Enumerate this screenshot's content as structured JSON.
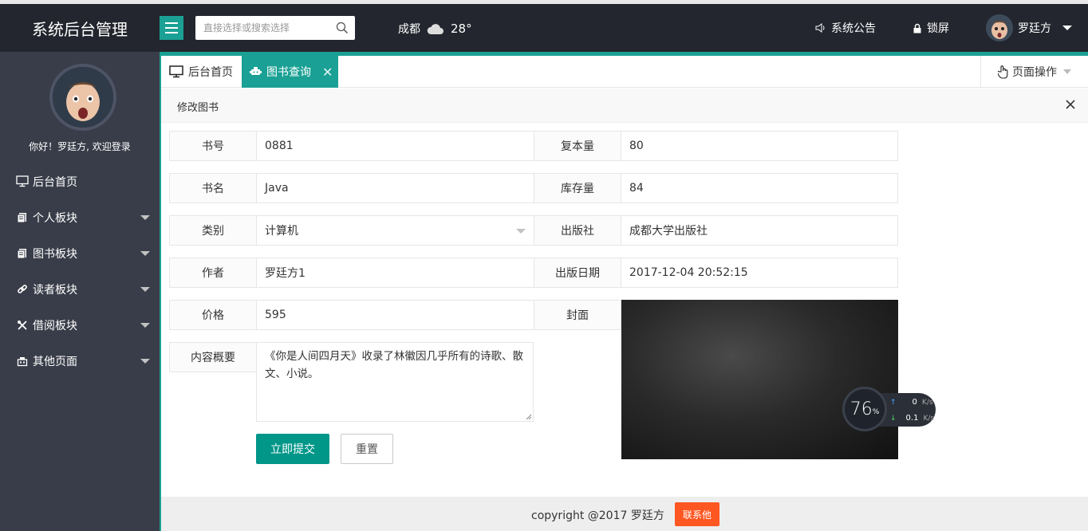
{
  "app": {
    "title": "系统后台管理",
    "search_placeholder": "直接选择或搜索选择"
  },
  "weather": {
    "city": "成都",
    "temp": "28°"
  },
  "header": {
    "notice_label": "系统公告",
    "lock_label": "锁屏",
    "username": "罗廷方"
  },
  "sidebar": {
    "welcome": "你好！罗廷方, 欢迎登录",
    "items": [
      {
        "label": "后台首页",
        "icon": "monitor-icon"
      },
      {
        "label": "个人板块",
        "icon": "document-icon"
      },
      {
        "label": "图书板块",
        "icon": "document-icon"
      },
      {
        "label": "读者板块",
        "icon": "link-icon"
      },
      {
        "label": "借阅板块",
        "icon": "tools-icon"
      },
      {
        "label": "其他页面",
        "icon": "building-icon"
      }
    ]
  },
  "tabs": {
    "home": "后台首页",
    "active": "图书查询",
    "page_ops": "页面操作"
  },
  "panel": {
    "title": "修改图书"
  },
  "form": {
    "book_no": {
      "label": "书号",
      "value": "0881"
    },
    "copies": {
      "label": "复本量",
      "value": "80"
    },
    "name": {
      "label": "书名",
      "value": "Java"
    },
    "stock": {
      "label": "库存量",
      "value": "84"
    },
    "category": {
      "label": "类别",
      "value": "计算机"
    },
    "publisher": {
      "label": "出版社",
      "value": "成都大学出版社"
    },
    "author": {
      "label": "作者",
      "value": "罗廷方1"
    },
    "pub_date": {
      "label": "出版日期",
      "value": "2017-12-04 20:52:15"
    },
    "price": {
      "label": "价格",
      "value": "595"
    },
    "cover": {
      "label": "封面"
    },
    "summary": {
      "label": "内容概要",
      "value": "《你是人间四月天》收录了林徽因几乎所有的诗歌、散文、小说。"
    },
    "submit": "立即提交",
    "reset": "重置"
  },
  "netspeed": {
    "percent": "76",
    "percent_unit": "%",
    "up": "0",
    "down": "0.1",
    "unit": "K/s"
  },
  "footer": {
    "copyright": "copyright @2017 罗廷方",
    "contact": "联系他"
  },
  "colors": {
    "accent": "#1aa094",
    "submit": "#009688",
    "contact": "#ff5722",
    "topbar": "#23262e",
    "sidebar": "#393d49"
  }
}
